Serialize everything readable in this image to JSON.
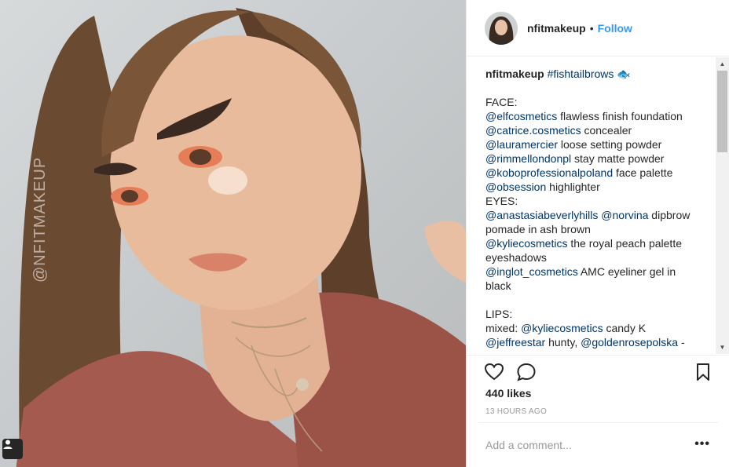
{
  "post": {
    "username": "nfitmakeup",
    "separator": "•",
    "follow_label": "Follow",
    "photo_watermark": "@NFITMAKEUP"
  },
  "caption": {
    "username": "nfitmakeup",
    "hashtag": "#fishtailbrows",
    "lines": [
      {
        "text": "FACE:"
      },
      {
        "mention": "@elfcosmetics",
        "text": " flawless finish foundation"
      },
      {
        "mention": "@catrice.cosmetics",
        "text": " concealer"
      },
      {
        "mention": "@lauramercier",
        "text": " loose setting powder"
      },
      {
        "mention": "@rimmellondonpl",
        "text": " stay matte powder"
      },
      {
        "mention": "@koboprofessionalpoland",
        "text": " face palette"
      },
      {
        "mention": "@obsession",
        "text": " highlighter"
      },
      {
        "text": "EYES:"
      },
      {
        "mention": "@anastasiabeverlyhills",
        "text": " ",
        "mention2": "@norvina",
        "text2": " dipbrow"
      },
      {
        "text": "pomade in ash brown"
      },
      {
        "mention": "@kyliecosmetics",
        "text": " the royal peach palette"
      },
      {
        "text": "eyeshadows"
      },
      {
        "mention": "@inglot_cosmetics",
        "text": " AMC eyeliner gel in"
      },
      {
        "text": "black"
      },
      {
        "text": ""
      },
      {
        "text": "LIPS:"
      },
      {
        "text": "mixed: ",
        "mention2": "@kyliecosmetics",
        "text2": " candy K"
      },
      {
        "mention": "@jeffreestar",
        "text": " hunty, ",
        "mention2": "@goldenrosepolska",
        "text2": " -"
      }
    ]
  },
  "stats": {
    "likes": "440 likes",
    "time": "13 HOURS AGO"
  },
  "comment": {
    "placeholder": "Add a comment...",
    "more_label": "•••"
  },
  "icons": {
    "like": "heart-icon",
    "comment": "speech-bubble-icon",
    "save": "bookmark-icon",
    "tag": "user-tag-icon",
    "emoji": "fish-emoji"
  },
  "colors": {
    "link": "#003569",
    "follow": "#3897f0",
    "text": "#262626",
    "muted": "#999999"
  }
}
